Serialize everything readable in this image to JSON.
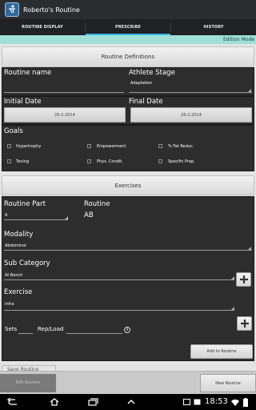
{
  "app": {
    "title": "Roberto's Routine"
  },
  "tabs": [
    {
      "label": "ROUTINE DISPLAY",
      "active": false
    },
    {
      "label": "PRESCRIBE",
      "active": true
    },
    {
      "label": "HISTORY",
      "active": false
    }
  ],
  "mode_banner": "Edition Mode",
  "routine_definitions": {
    "header": "Routine Definitions",
    "routine_name_label": "Routine name",
    "routine_name_value": "",
    "athlete_stage_label": "Athlete Stage",
    "athlete_stage_value": "Adaptation",
    "initial_date_label": "Initial Date",
    "initial_date_value": "26-2-2014",
    "final_date_label": "Final Date",
    "final_date_value": "26-2-2014"
  },
  "goals": {
    "label": "Goals",
    "options": [
      {
        "label": "Hypertrophy",
        "checked": false
      },
      {
        "label": "Empowerment",
        "checked": false
      },
      {
        "label": "% Fat Reduc.",
        "checked": false
      },
      {
        "label": "Toning",
        "checked": false
      },
      {
        "label": "Phys. Condit.",
        "checked": false
      },
      {
        "label": "Specific Prep.",
        "checked": false
      }
    ]
  },
  "exercises": {
    "header": "Exercises",
    "routine_part_label": "Routine Part",
    "routine_part_value": "A",
    "routine_label": "Routine",
    "routine_value": "AB",
    "modality_label": "Modality",
    "modality_value": "Abdominal",
    "subcategory_label": "Sub Category",
    "subcategory_value": "At Bench",
    "exercise_label": "Exercise",
    "exercise_value": "Infra",
    "sets_label": "Sets",
    "rep_load_label": "Rep/Load",
    "add_button": "Add to Routine"
  },
  "saved_routine_partial": "Save Routine",
  "bottom": {
    "edit_button": "Edit Routine",
    "new_button": "New Routine"
  },
  "status": {
    "clock": "18:53"
  }
}
